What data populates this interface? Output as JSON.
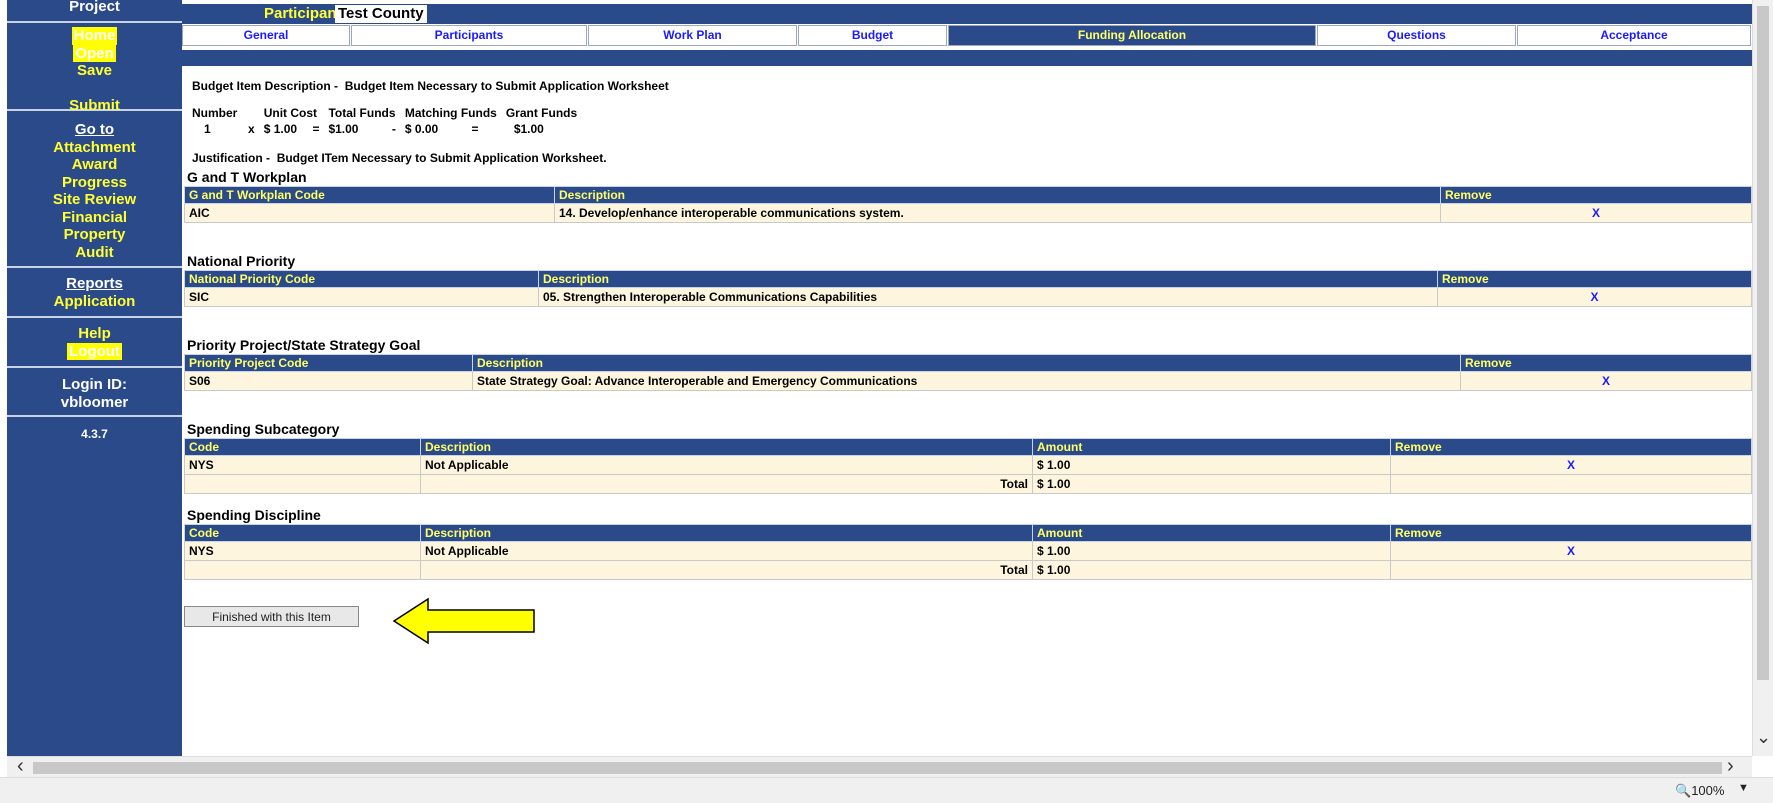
{
  "sidebar": {
    "project_label": "Project",
    "nav1": [
      "Home",
      "Open",
      "Save",
      "",
      "Submit"
    ],
    "goto_label": "Go to",
    "goto_items": [
      "Attachment",
      "Award",
      "Progress",
      "Site Review",
      "Financial",
      "Property",
      "Audit"
    ],
    "reports_label": "Reports",
    "reports_items": [
      "Application"
    ],
    "help_items": [
      "Help",
      "Logout"
    ],
    "login_label": "Login ID:",
    "login_id": "vbloomer",
    "version": "4.3.7"
  },
  "header": {
    "participant_label": "Participant:",
    "participant_value": "Test County"
  },
  "tabs": [
    {
      "label": "General"
    },
    {
      "label": "Participants"
    },
    {
      "label": "Work Plan"
    },
    {
      "label": "Budget"
    },
    {
      "label": "Funding Allocation"
    },
    {
      "label": "Questions"
    },
    {
      "label": "Acceptance"
    }
  ],
  "budget_item": {
    "description_label": "Budget Item Description -",
    "description_value": "Budget Item Necessary to Submit Application Worksheet",
    "headers": [
      "Number",
      "Unit Cost",
      "Total Funds",
      "Matching Funds",
      "Grant Funds"
    ],
    "number": "1",
    "op_x": "x",
    "unit_cost": "$ 1.00",
    "op_eq1": "=",
    "total_funds": "$1.00",
    "op_minus": "-",
    "matching_funds": "$ 0.00",
    "op_eq2": "=",
    "grant_funds": "$1.00",
    "justification_label": "Justification -",
    "justification_value": "Budget ITem Necessary to Submit Application Worksheet."
  },
  "workplan": {
    "title": "G and T Workplan",
    "headers": [
      "G and T Workplan Code",
      "Description",
      "Remove"
    ],
    "rows": [
      {
        "code": "AIC",
        "description": "14. Develop/enhance interoperable communications system.",
        "remove": "X"
      }
    ]
  },
  "national_priority": {
    "title": "National Priority",
    "headers": [
      "National Priority Code",
      "Description",
      "Remove"
    ],
    "rows": [
      {
        "code": "SIC",
        "description": "05. Strengthen Interoperable Communications Capabilities",
        "remove": "X"
      }
    ]
  },
  "priority_project": {
    "title": "Priority Project/State Strategy Goal",
    "headers": [
      "Priority Project Code",
      "Description",
      "Remove"
    ],
    "rows": [
      {
        "code": "S06",
        "description": "State Strategy Goal: Advance Interoperable and Emergency Communications",
        "remove": "X"
      }
    ]
  },
  "spending_subcategory": {
    "title": "Spending Subcategory",
    "headers": [
      "Code",
      "Description",
      "Amount",
      "Remove"
    ],
    "rows": [
      {
        "code": "NYS",
        "description": "Not Applicable",
        "amount": "$ 1.00",
        "remove": "X"
      }
    ],
    "total_label": "Total",
    "total_value": "$ 1.00"
  },
  "spending_discipline": {
    "title": "Spending Discipline",
    "headers": [
      "Code",
      "Description",
      "Amount",
      "Remove"
    ],
    "rows": [
      {
        "code": "NYS",
        "description": "Not Applicable",
        "amount": "$ 1.00",
        "remove": "X"
      }
    ],
    "total_label": "Total",
    "total_value": "$ 1.00"
  },
  "finish_button": "Finished with this Item",
  "status": {
    "zoom": "100%"
  },
  "colors": {
    "nav_blue": "#2b4a8a",
    "link_yellow": "#ffff33",
    "row_bg": "#fdf5dd",
    "arrow_yellow": "#ffff00"
  }
}
